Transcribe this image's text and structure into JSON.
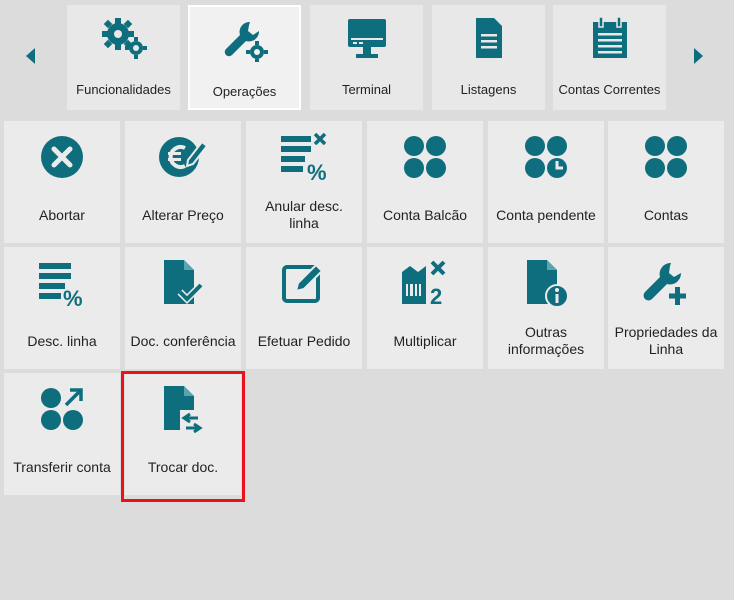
{
  "colors": {
    "accent": "#0f6e7e",
    "highlight": "#e8131b",
    "background": "#dcdcdc",
    "tile": "#ebebeb"
  },
  "tabs": [
    {
      "label": "Funcionalidades",
      "icon": "gears-icon"
    },
    {
      "label": "Operações",
      "icon": "wrench-gear-icon",
      "active": true
    },
    {
      "label": "Terminal",
      "icon": "monitor-icon"
    },
    {
      "label": "Listagens",
      "icon": "document-list-icon"
    },
    {
      "label": "Contas Correntes",
      "icon": "calendar-icon"
    }
  ],
  "tiles": [
    {
      "label": "Abortar",
      "icon": "cancel-circle-icon"
    },
    {
      "label": "Alterar Preço",
      "icon": "euro-edit-icon"
    },
    {
      "label": "Anular desc. linha",
      "icon": "cancel-discount-icon"
    },
    {
      "label": "Conta Balcão",
      "icon": "four-circles-icon"
    },
    {
      "label": "Conta pendente",
      "icon": "circles-clock-icon"
    },
    {
      "label": "Contas",
      "icon": "four-circles-icon"
    },
    {
      "label": "Desc. linha",
      "icon": "discount-lines-icon"
    },
    {
      "label": "Doc. conferência",
      "icon": "document-check-icon"
    },
    {
      "label": "Efetuar Pedido",
      "icon": "edit-square-icon"
    },
    {
      "label": "Multiplicar",
      "icon": "barcode-multiply-icon"
    },
    {
      "label": "Outras informações",
      "icon": "document-info-icon"
    },
    {
      "label": "Propriedades da Linha",
      "icon": "wrench-plus-icon"
    },
    {
      "label": "Transferir conta",
      "icon": "circles-transfer-icon"
    },
    {
      "label": "Trocar doc.",
      "icon": "document-swap-icon"
    }
  ]
}
